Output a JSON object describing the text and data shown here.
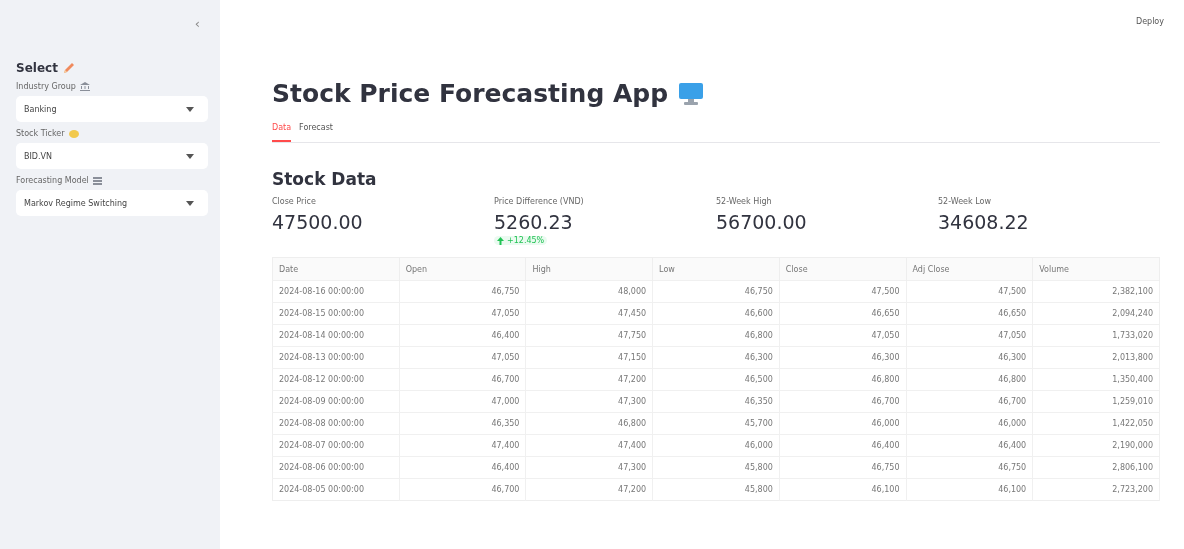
{
  "sidebar": {
    "collapse": "‹",
    "heading": "Select",
    "selects": [
      {
        "label": "Industry Group",
        "value": "Banking"
      },
      {
        "label": "Stock Ticker",
        "value": "BID.VN"
      },
      {
        "label": "Forecasting Model",
        "value": "Markov Regime Switching"
      }
    ]
  },
  "header": {
    "deploy": "Deploy"
  },
  "title": "Stock Price Forecasting App",
  "tabs": [
    {
      "label": "Data",
      "selected": true
    },
    {
      "label": "Forecast",
      "selected": false
    }
  ],
  "section": "Stock Data",
  "metrics": [
    {
      "label": "Close Price",
      "value": "47500.00"
    },
    {
      "label": "Price Difference (VND)",
      "value": "5260.23",
      "delta": "+12.45%"
    },
    {
      "label": "52-Week High",
      "value": "56700.00"
    },
    {
      "label": "52-Week Low",
      "value": "34608.22"
    }
  ],
  "table": {
    "columns": [
      "Date",
      "Open",
      "High",
      "Low",
      "Close",
      "Adj Close",
      "Volume"
    ],
    "rows": [
      [
        "2024-08-16 00:00:00",
        "46,750",
        "48,000",
        "46,750",
        "47,500",
        "47,500",
        "2,382,100"
      ],
      [
        "2024-08-15 00:00:00",
        "47,050",
        "47,450",
        "46,600",
        "46,650",
        "46,650",
        "2,094,240"
      ],
      [
        "2024-08-14 00:00:00",
        "46,400",
        "47,750",
        "46,800",
        "47,050",
        "47,050",
        "1,733,020"
      ],
      [
        "2024-08-13 00:00:00",
        "47,050",
        "47,150",
        "46,300",
        "46,300",
        "46,300",
        "2,013,800"
      ],
      [
        "2024-08-12 00:00:00",
        "46,700",
        "47,200",
        "46,500",
        "46,800",
        "46,800",
        "1,350,400"
      ],
      [
        "2024-08-09 00:00:00",
        "47,000",
        "47,300",
        "46,350",
        "46,700",
        "46,700",
        "1,259,010"
      ],
      [
        "2024-08-08 00:00:00",
        "46,350",
        "46,800",
        "45,700",
        "46,000",
        "46,000",
        "1,422,050"
      ],
      [
        "2024-08-07 00:00:00",
        "47,400",
        "47,400",
        "46,000",
        "46,400",
        "46,400",
        "2,190,000"
      ],
      [
        "2024-08-06 00:00:00",
        "46,400",
        "47,300",
        "45,800",
        "46,750",
        "46,750",
        "2,806,100"
      ],
      [
        "2024-08-05 00:00:00",
        "46,700",
        "47,200",
        "45,800",
        "46,100",
        "46,100",
        "2,723,200"
      ]
    ]
  }
}
